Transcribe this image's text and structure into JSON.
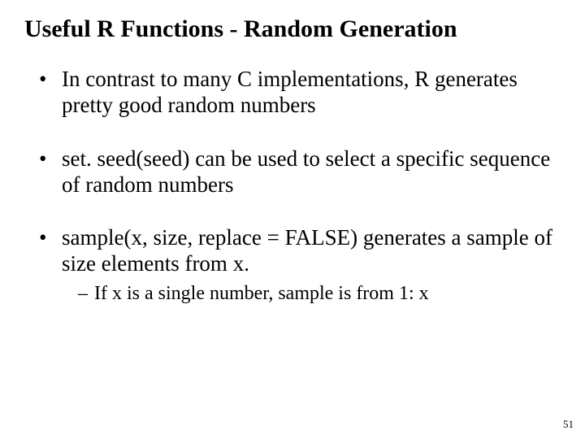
{
  "title": "Useful R Functions - Random Generation",
  "bullets": {
    "b1": {
      "pre": "In contrast to many ",
      "c": "C",
      "mid": " implementations, ",
      "r": "R",
      "post": " generates pretty good random numbers"
    },
    "b2": {
      "lead": " ",
      "fn": "set. seed(seed)",
      "rest": " can be used to select a specific sequence of random numbers"
    },
    "b3": {
      "lead": " ",
      "fn": "sample(x, size, replace = FALSE)",
      "rest1": " generates a sample of ",
      "sz": "size",
      "rest2": " elements from ",
      "x": "x",
      "period": "."
    },
    "sub1": {
      "pre": "If ",
      "x": "x",
      "mid": " is a single number, sample is from ",
      "rng": "1: x"
    }
  },
  "page": "51"
}
